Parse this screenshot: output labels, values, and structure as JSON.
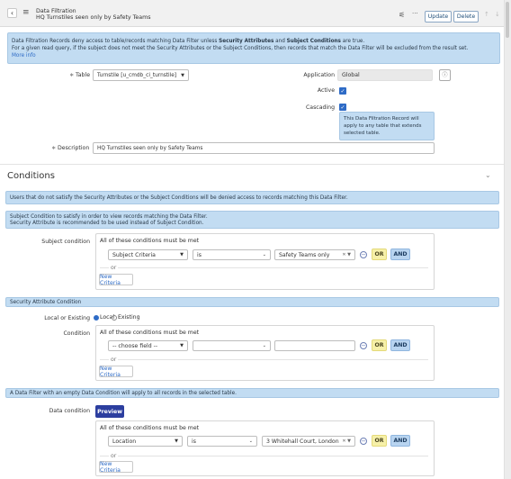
{
  "header": {
    "record_type": "Data Filtration",
    "record_name": "HQ Turnstiles seen only by Safety Teams",
    "update_label": "Update",
    "delete_label": "Delete",
    "more_label": "···"
  },
  "intro": {
    "line1_a": "Data Filtration Records deny access to table/records matching Data Filter unless ",
    "line1_b": "Security Attributes",
    "line1_c": " and ",
    "line1_d": "Subject Conditions",
    "line1_e": " are true.",
    "line2": "For a given read query, if the subject does not meet the Security Attributes or the Subject Conditions, then records that match the Data Filter will be excluded from the result set.",
    "more_info": "More info"
  },
  "form": {
    "table_label": "Table",
    "table_value": "Turnstile [u_cmdb_ci_turnstile]",
    "application_label": "Application",
    "application_value": "Global",
    "active_label": "Active",
    "cascading_label": "Cascading",
    "cascading_hint": "This Data Filtration Record will apply to any table that extends selected table.",
    "description_label": "Description",
    "description_value": "HQ Turnstiles seen only by Safety Teams",
    "required_mark": "∗"
  },
  "conditions": {
    "title": "Conditions",
    "deny_note": "Users that do not satisfy the Security Attributes or the Subject Conditions will be denied access to records matching this Data Filter.",
    "subject_note_1": "Subject Condition to satisfy in order to view records matching the Data Filter.",
    "subject_note_2": "Security Attribute is recommended to be used instead of Subject Condition.",
    "subject_label": "Subject condition",
    "all_conditions": "All of these conditions must be met",
    "subject_field": "Subject Criteria",
    "subject_operator": "is",
    "subject_value": "Safety Teams only",
    "or_label": "OR",
    "and_label": "AND",
    "or_text": "or",
    "new_criteria": "New Criteria",
    "security_header": "Security Attribute Condition",
    "local_existing_label": "Local or Existing",
    "radio_local": "Local",
    "radio_existing": "Existing",
    "condition_label": "Condition",
    "choose_field": "-- choose field --",
    "empty_filter_note": "A Data Filter with an empty Data Condition will apply to all records in the selected table.",
    "data_condition_label": "Data condition",
    "preview_label": "Preview",
    "data_field": "Location",
    "data_operator": "is",
    "data_value": "3 Whitehall Court, London"
  }
}
